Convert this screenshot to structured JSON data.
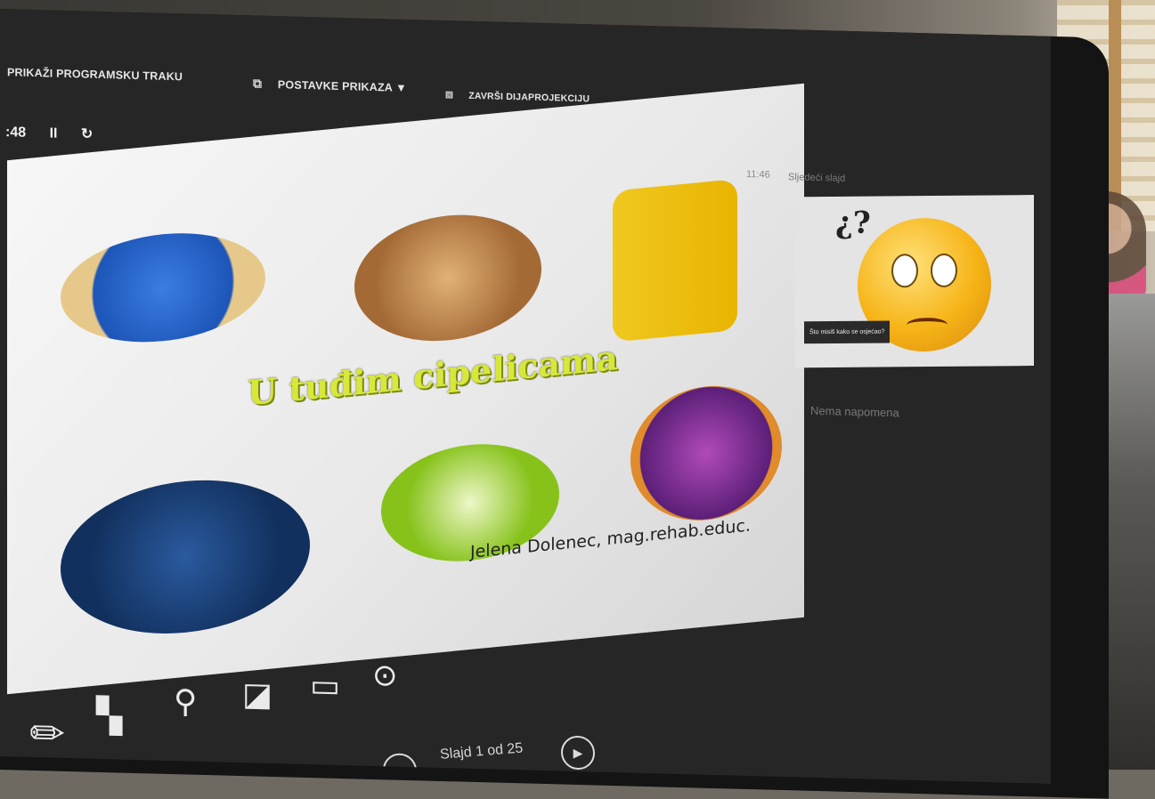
{
  "toolbar": {
    "show_taskbar": "PRIKAŽI PROGRAMSKU TRAKU",
    "display_settings": "POSTAVKE PRIKAZA ▼",
    "end_slideshow": "ZAVRŠI DIJAPROJEKCIJU"
  },
  "timer": {
    "elapsed": ":48",
    "pause_symbol": "II",
    "reset_symbol": "↻"
  },
  "slide": {
    "title": "U tuđim cipelicama",
    "author": "Jelena Dolenec, mag.rehab.educ."
  },
  "right_panel": {
    "clock": "11:46",
    "next_slide_label": "Sljedeći slajd",
    "preview_caption": "Što misiš kako se osjećao?",
    "notes": "Nema napomena"
  },
  "navigation": {
    "slide_counter": "Slajd 1 od 25"
  },
  "icons": [
    "pen-icon",
    "all-slides-icon",
    "zoom-icon",
    "black-screen-icon",
    "subtitles-icon",
    "more-options-icon",
    "prev-icon",
    "next-icon",
    "pause-icon",
    "reset-icon",
    "taskbar-icon",
    "display-settings-icon",
    "end-slideshow-icon"
  ]
}
